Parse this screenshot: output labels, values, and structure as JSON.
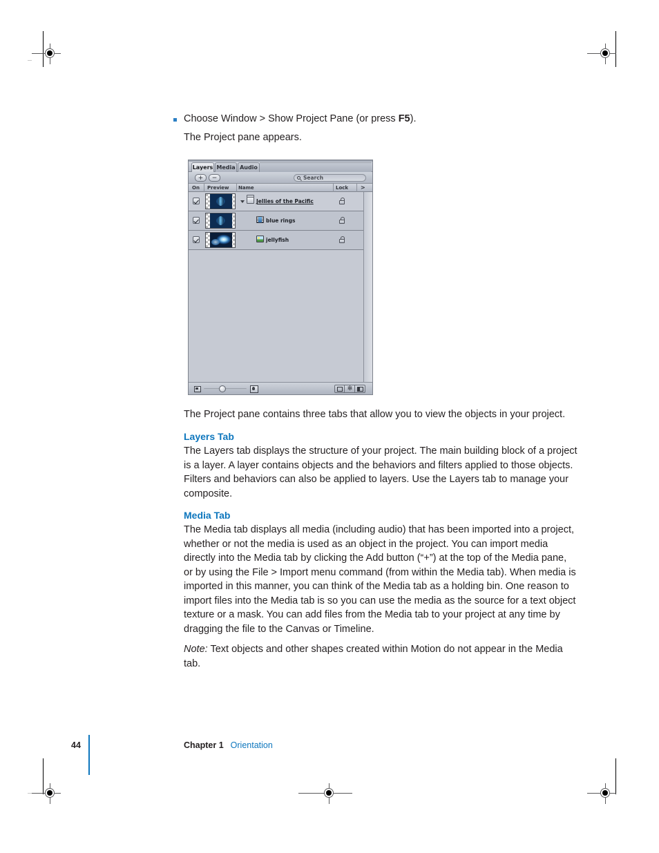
{
  "page": {
    "number": "44",
    "chapter": "Chapter 1",
    "section": "Orientation"
  },
  "steps": {
    "bullet_text": "Choose Window > Show Project Pane (or press F5).",
    "bullet_prefix": "Choose Window > Show Project Pane (or press ",
    "bullet_key": "F5",
    "bullet_suffix": ").",
    "result_text": "The Project pane appears."
  },
  "screenshot": {
    "app": "Motion Project Pane",
    "tabs": [
      {
        "label": "Layers",
        "active": true
      },
      {
        "label": "Media",
        "active": false
      },
      {
        "label": "Audio",
        "active": false
      }
    ],
    "toolbar": {
      "add_label": "+",
      "remove_label": "−",
      "search_placeholder": "Search"
    },
    "columns": {
      "on": "On",
      "preview": "Preview",
      "name": "Name",
      "lock": "Lock",
      "more": ">"
    },
    "rows": [
      {
        "checked": true,
        "name": "Jellies of the Pacific",
        "icon": "layer-group-icon",
        "type": "group",
        "selected": true,
        "expanded": true,
        "underlined": true,
        "locked": false,
        "indent": 0
      },
      {
        "checked": true,
        "name": "blue rings",
        "icon": "movie-clip-icon",
        "type": "movie",
        "selected": false,
        "expanded": false,
        "underlined": false,
        "locked": false,
        "indent": 1
      },
      {
        "checked": true,
        "name": "jellyfish",
        "icon": "image-file-icon",
        "type": "photo",
        "selected": false,
        "expanded": false,
        "underlined": false,
        "locked": false,
        "indent": 1
      }
    ],
    "bottom_bar": {
      "small_icon": "small-thumbnail-icon",
      "large_icon": "large-thumbnail-icon",
      "slider_name": "thumbnail-size-slider",
      "buttons": [
        {
          "name": "mask-view-button",
          "glyph": ""
        },
        {
          "name": "settings-button",
          "glyph": "✻"
        },
        {
          "name": "pane-layout-button",
          "glyph": ""
        }
      ]
    }
  },
  "body": {
    "intro": "The Project pane contains three tabs that allow you to view the objects in your project.",
    "sections": [
      {
        "heading": "Layers Tab",
        "text": "The Layers tab displays the structure of your project. The main building block of a project is a layer. A layer contains objects and the behaviors and filters applied to those objects. Filters and behaviors can also be applied to layers. Use the Layers tab to manage your composite."
      },
      {
        "heading": "Media Tab",
        "text": "The Media tab displays all media (including audio) that has been imported into a project, whether or not the media is used as an object in the project. You can import media directly into the Media tab by clicking the Add button (“+”) at the top of the Media pane, or by using the File > Import menu command (from within the Media tab). When media is imported in this manner, you can think of the Media tab as a holding bin. One reason to import files into the Media tab is so you can use the media as the source for a text object texture or a mask. You can add files from the Media tab to your project at any time by dragging the file to the Canvas or Timeline."
      }
    ],
    "note_label": "Note:",
    "note_text": "Text objects and other shapes created within Motion do not appear in the Media tab."
  },
  "colors": {
    "accent_blue": "#0d76bd",
    "bullet_blue": "#2b7fc4",
    "body_text": "#231f20"
  }
}
